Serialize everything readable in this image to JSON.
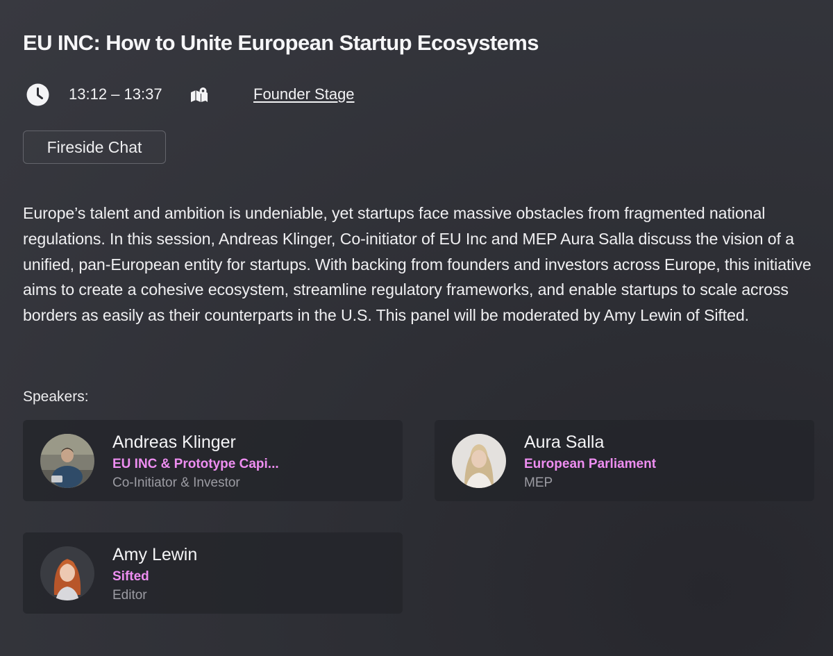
{
  "session": {
    "title": "EU INC: How to Unite European Startup Ecosystems",
    "time": "13:12 – 13:37",
    "stage": "Founder Stage",
    "format": "Fireside Chat",
    "description": "Europe’s talent and ambition is undeniable, yet startups face massive obstacles from fragmented national regulations. In this session, Andreas Klinger, Co-initiator of EU Inc and MEP Aura Salla discuss the vision of a unified, pan-European entity for startups. With backing from founders and investors across Europe, this initiative aims to create a cohesive ecosystem, streamline regulatory frameworks, and enable startups to scale across borders as easily as their counterparts in the U.S. This panel will be moderated by Amy Lewin of Sifted."
  },
  "icons": {
    "time": "clock-icon",
    "location": "map-icon"
  },
  "speakers_label": "Speakers:",
  "speakers": [
    {
      "name": "Andreas Klinger",
      "organization": "EU INC & Prototype Capi...",
      "role": "Co-Initiator & Investor"
    },
    {
      "name": "Aura Salla",
      "organization": "European Parliament",
      "role": "MEP"
    },
    {
      "name": "Amy Lewin",
      "organization": "Sifted",
      "role": "Editor"
    }
  ],
  "colors": {
    "background": "#2d2e34",
    "accent": "#ee8ef1",
    "card": "#232429",
    "muted_text": "#9c9ca3"
  }
}
